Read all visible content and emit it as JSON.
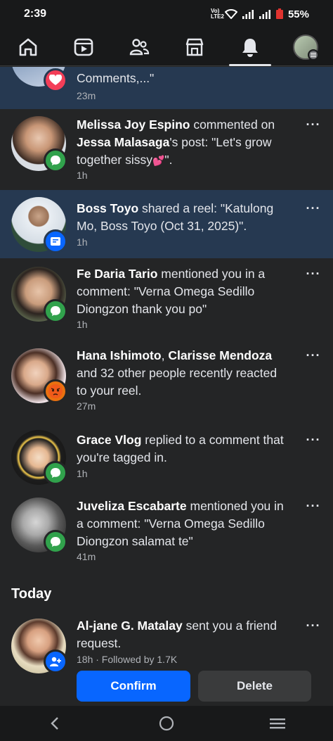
{
  "status_bar": {
    "time": "2:39",
    "network": "Vo) LTE2",
    "battery": "55%"
  },
  "nav": {
    "items": [
      {
        "name": "home",
        "icon": "home-icon"
      },
      {
        "name": "video",
        "icon": "video-icon"
      },
      {
        "name": "friends",
        "icon": "friends-icon"
      },
      {
        "name": "marketplace",
        "icon": "marketplace-icon"
      },
      {
        "name": "notifications",
        "icon": "bell-icon",
        "active": true
      },
      {
        "name": "profile",
        "icon": "avatar"
      }
    ]
  },
  "notifications": [
    {
      "text_line": "Comments,...\"",
      "time": "23m",
      "badge": "heart-icon",
      "badge_color": "#f33e58",
      "unread": true
    },
    {
      "actor": "Melissa Joy Espino",
      "text1": " commented on ",
      "actor2": "Jessa Malasaga",
      "text2": "'s post: \"Let's grow together sissy",
      "emoji": "💕",
      "text3": "\".",
      "time": "1h",
      "badge": "comment-icon",
      "badge_color": "#31a24c"
    },
    {
      "actor": "Boss Toyo",
      "text1": " shared a reel: \"Katulong Mo, Boss Toyo (Oct 31, 2025)\".",
      "time": "1h",
      "badge": "reel-icon",
      "badge_color": "#0866ff",
      "unread": true
    },
    {
      "actor": "Fe Daria Tario",
      "text1": " mentioned you in a comment: \"Verna Omega Sedillo Diongzon thank you po\"",
      "time": "1h",
      "badge": "comment-icon",
      "badge_color": "#31a24c"
    },
    {
      "actor": "Hana Ishimoto",
      "text1": ", ",
      "actor2": "Clarisse Mendoza",
      "text2": " and 32 other people recently reacted to your reel.",
      "time": "27m",
      "badge": "angry-icon",
      "badge_color": "#f7b125"
    },
    {
      "actor": "Grace Vlog",
      "text1": " replied to a comment that you're tagged in.",
      "time": "1h",
      "badge": "comment-icon",
      "badge_color": "#31a24c"
    },
    {
      "actor": "Juveliza Escabarte",
      "text1": " mentioned you in a comment: \"Verna Omega Sedillo Diongzon salamat te\"",
      "time": "41m",
      "badge": "comment-icon",
      "badge_color": "#31a24c"
    }
  ],
  "today": {
    "title": "Today",
    "request": {
      "actor": "Al-jane G. Matalay",
      "text1": " sent you a friend request.",
      "meta": "18h · Followed by 1.7K",
      "badge": "add-friend-icon",
      "badge_color": "#0866ff",
      "confirm_label": "Confirm",
      "delete_label": "Delete"
    }
  },
  "more_label": "···"
}
